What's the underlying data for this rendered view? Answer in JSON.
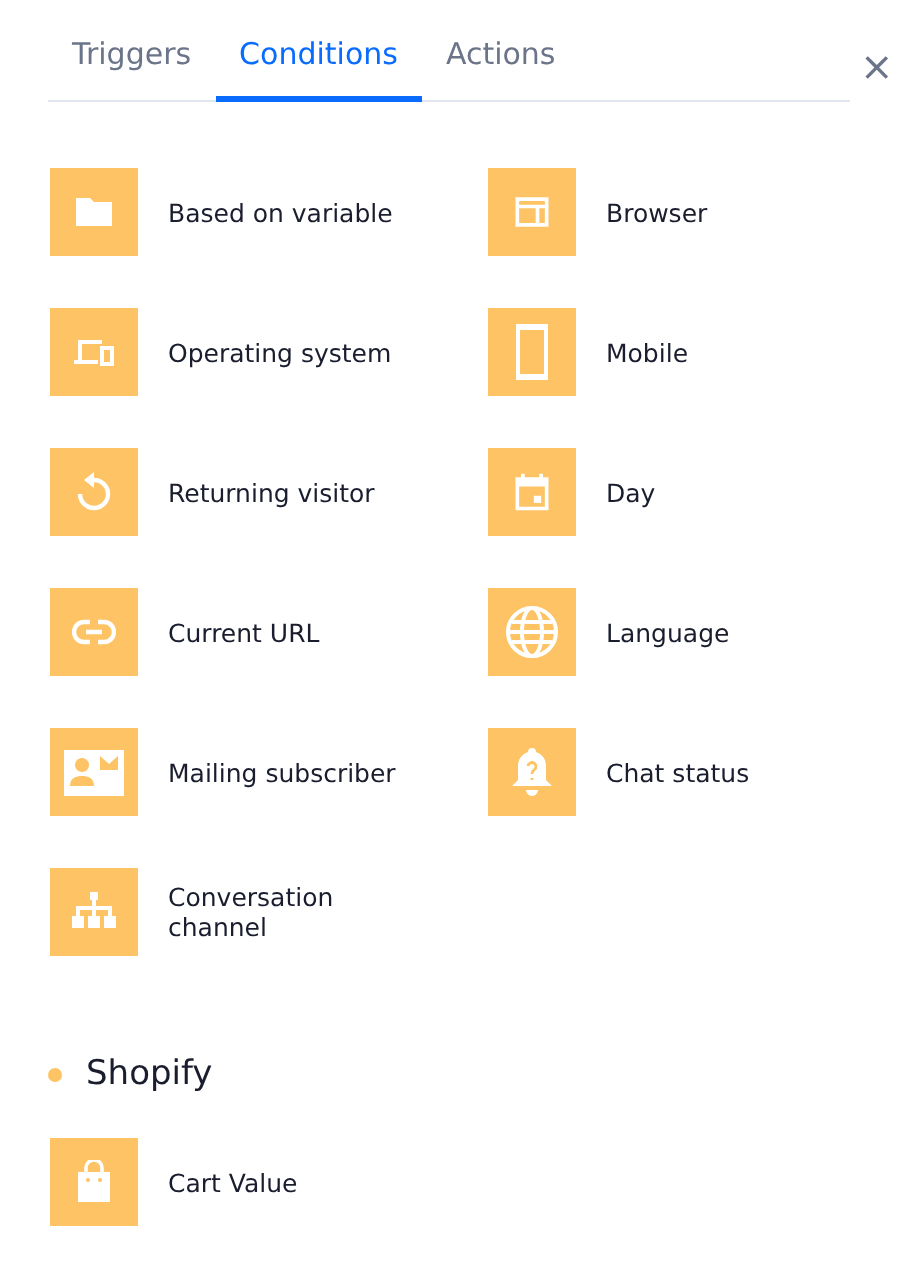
{
  "tabs": [
    {
      "label": "Triggers",
      "selected": false
    },
    {
      "label": "Conditions",
      "selected": true
    },
    {
      "label": "Actions",
      "selected": false
    }
  ],
  "close": "×",
  "conditions": [
    {
      "label": "Based on variable"
    },
    {
      "label": "Browser"
    },
    {
      "label": "Operating system"
    },
    {
      "label": "Mobile"
    },
    {
      "label": "Returning visitor"
    },
    {
      "label": "Day"
    },
    {
      "label": "Current URL"
    },
    {
      "label": "Language"
    },
    {
      "label": "Mailing subscriber"
    },
    {
      "label": "Chat status"
    },
    {
      "label": "Conversation channel"
    }
  ],
  "sections": [
    {
      "title": "Shopify",
      "items": [
        {
          "label": "Cart Value"
        }
      ]
    }
  ]
}
